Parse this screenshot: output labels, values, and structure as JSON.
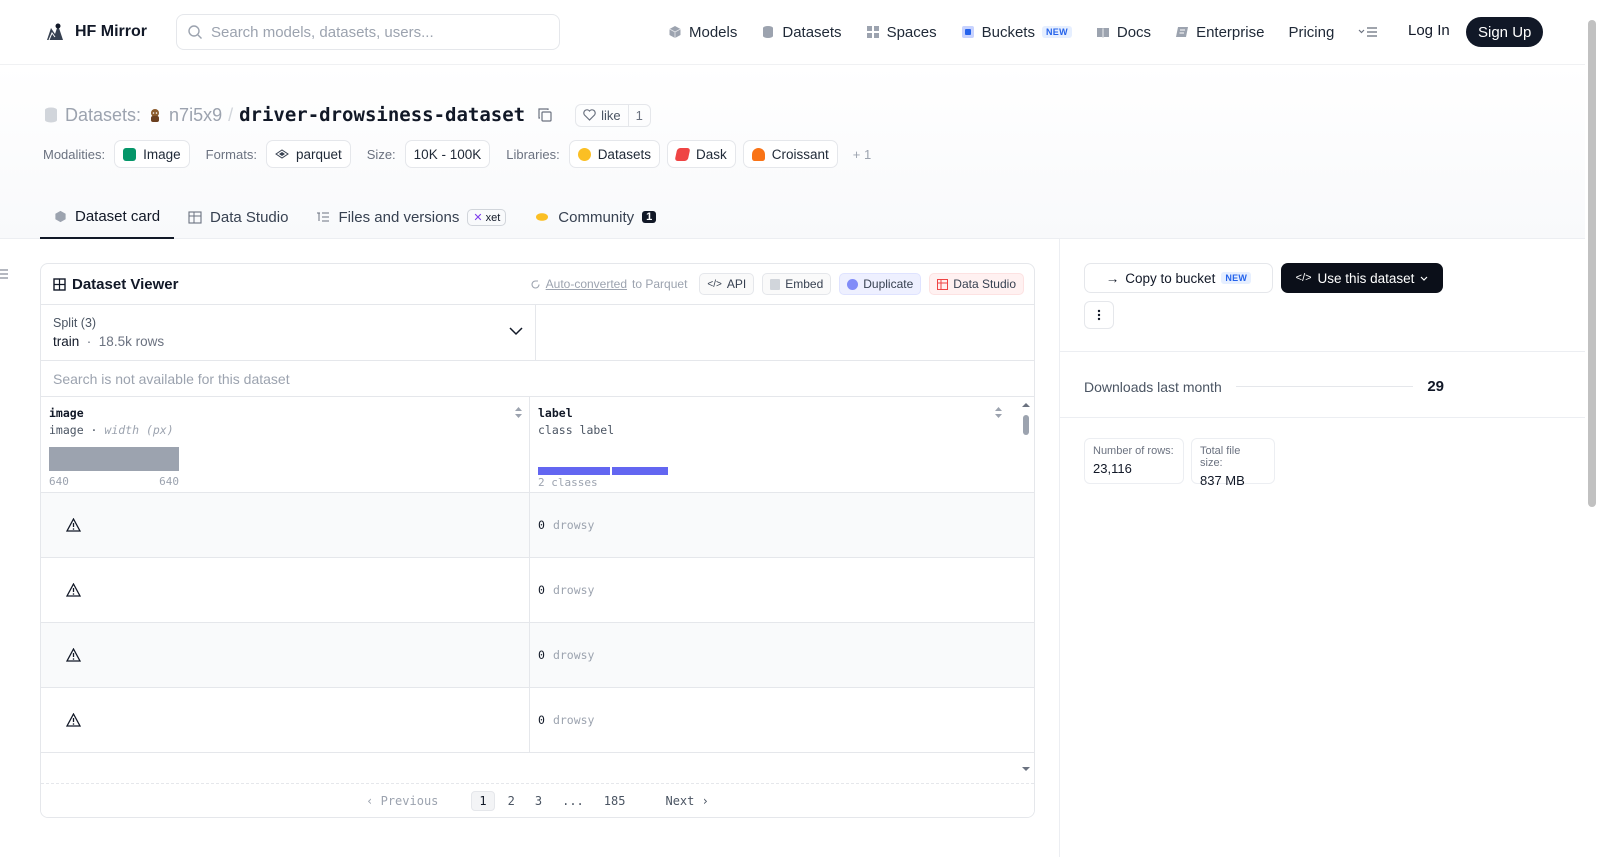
{
  "topnav": {
    "brand": "HF Mirror",
    "search_placeholder": "Search models, datasets, users...",
    "items": [
      {
        "label": "Models",
        "icon": "cube-icon"
      },
      {
        "label": "Datasets",
        "icon": "database-icon"
      },
      {
        "label": "Spaces",
        "icon": "grid-icon"
      },
      {
        "label": "Buckets",
        "icon": "bucket-icon",
        "badge": "NEW"
      },
      {
        "label": "Docs",
        "icon": "book-icon"
      },
      {
        "label": "Enterprise",
        "icon": "enterprise-icon"
      },
      {
        "label": "Pricing"
      }
    ],
    "login": "Log In",
    "signup": "Sign Up"
  },
  "header": {
    "section": "Datasets:",
    "owner": "n7i5x9",
    "separator": "/",
    "repo": "driver-drowsiness-dataset",
    "like_label": "like",
    "like_count": "1",
    "tags": {
      "modalities_key": "Modalities:",
      "modality": "Image",
      "formats_key": "Formats:",
      "format": "parquet",
      "size_key": "Size:",
      "size": "10K - 100K",
      "libraries_key": "Libraries:",
      "libraries": [
        "Datasets",
        "Dask",
        "Croissant"
      ],
      "more": "+ 1"
    }
  },
  "tabs": [
    {
      "label": "Dataset card",
      "active": true
    },
    {
      "label": "Data Studio"
    },
    {
      "label": "Files and versions",
      "badge": "xet"
    },
    {
      "label": "Community",
      "count": "1"
    }
  ],
  "viewer": {
    "title": "Dataset Viewer",
    "auto_link": "Auto-converted",
    "auto_rest": "to Parquet",
    "buttons": {
      "api": "API",
      "embed": "Embed",
      "duplicate": "Duplicate",
      "studio": "Data Studio"
    },
    "split_label": "Split (3)",
    "split_value": "train",
    "split_rows": "18.5k rows",
    "search_disabled": "Search is not available for this dataset",
    "columns": [
      {
        "name": "image",
        "type": "image",
        "type_note": "width (px)",
        "min": "640",
        "max": "640"
      },
      {
        "name": "label",
        "type": "class label",
        "summary": "2 classes"
      }
    ],
    "rows": [
      {
        "label_id": "0",
        "label_name": "drowsy"
      },
      {
        "label_id": "0",
        "label_name": "drowsy"
      },
      {
        "label_id": "0",
        "label_name": "drowsy"
      },
      {
        "label_id": "0",
        "label_name": "drowsy"
      }
    ],
    "pager": {
      "prev": "Previous",
      "pages": [
        "1",
        "2",
        "3",
        "...",
        "185"
      ],
      "next": "Next",
      "current": "1"
    }
  },
  "right_panel": {
    "copy_label": "Copy to bucket",
    "copy_badge": "NEW",
    "use_label": "Use this dataset",
    "downloads_label": "Downloads last month",
    "downloads_value": "29",
    "rows_label": "Number of rows:",
    "rows_value": "23,116",
    "size_label": "Total file size:",
    "size_value": "837 MB"
  },
  "colors": {
    "accent": "#6366f1",
    "dark": "#111827",
    "muted": "#9ca3af"
  }
}
